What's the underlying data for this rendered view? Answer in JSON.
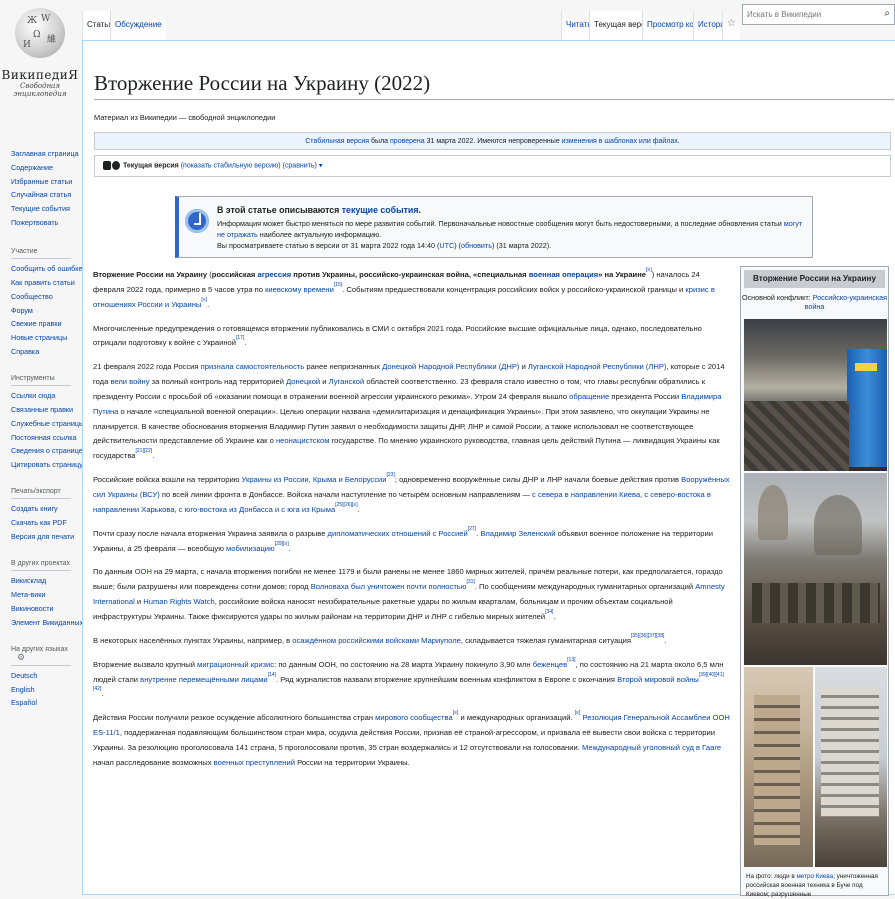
{
  "logo": {
    "wordmark": "ВикипедиЯ",
    "tagline": "Свободная энциклопедия"
  },
  "sidebar": {
    "portal_main": [
      "Заглавная страница",
      "Содержание",
      "Избранные статьи",
      "Случайная статья",
      "Текущие события",
      "Пожертвовать"
    ],
    "participation": {
      "title": "Участие",
      "items": [
        "Сообщить об ошибке",
        "Как править статьи",
        "Сообщество",
        "Форум",
        "Свежие правки",
        "Новые страницы",
        "Справка"
      ]
    },
    "tools": {
      "title": "Инструменты",
      "items": [
        "Ссылки сюда",
        "Связанные правки",
        "Служебные страницы",
        "Постоянная ссылка",
        "Сведения о странице",
        "Цитировать страницу"
      ]
    },
    "print": {
      "title": "Печать/экспорт",
      "items": [
        "Создать книгу",
        "Скачать как PDF",
        "Версия для печати"
      ]
    },
    "projects": {
      "title": "В других проектах",
      "items": [
        "Викисклад",
        "Мета-вики",
        "Викиновости",
        "Элемент Викиданных"
      ]
    },
    "languages": {
      "title": "На других языках",
      "items": [
        "Deutsch",
        "English",
        "Español"
      ]
    }
  },
  "tabs": {
    "article": "Статья",
    "talk": "Обсуждение",
    "read": "Читать",
    "current": "Текущая версия",
    "source": "Просмотр кода",
    "history": "История"
  },
  "search": {
    "placeholder": "Искать в Википедии"
  },
  "page": {
    "title": "Вторжение России на Украину (2022)",
    "site_sub": "Материал из Википедии — свободной энциклопедии"
  },
  "flag": {
    "stable": "Стабильная версия",
    "t1": " была ",
    "checked": "проверена",
    "t2": " 31 марта 2022. Имеются непроверенные ",
    "changes": "изменения в шаблонах или файлах",
    "t3": "."
  },
  "flaggedrev": {
    "bold": "Текущая версия",
    "rest": " (показать стабильную версию) (сравнить) ▾"
  },
  "current_events": {
    "h1": "В этой статье описываются ",
    "hlink": "текущие события",
    "h2": ".",
    "l1a": "Информация может быстро меняться по мере развития событий. Первоначальные новостные сообщения могут быть недостоверными, а последние обновления статьи ",
    "l1link": "могут не отражать",
    "l1b": " наиболее актуальную информацию.",
    "l2a": "Вы просматриваете статью в версии от 31 марта 2022 года 14:40 (",
    "utc": "UTC",
    "l2b": ") (",
    "refresh": "обновить",
    "l2c": ") (31 марта 2022)."
  },
  "infobox": {
    "title": "Вторжение России на Украину",
    "conflict_label": "Основной конфликт: ",
    "conflict_link": "Российско-украинская война",
    "caption_a": "На фото: люди в ",
    "caption_link": "метро Киева",
    "caption_b": "; уничтоженная российская военная техника в Буче под Киевом; разрушенные"
  },
  "body": {
    "p1": {
      "b1": "Вторжение России на Украину",
      "t1": " (",
      "b2": "российская ",
      "l1": "агрессия",
      "b3": " против Украины, российско-украинская война, «специальная ",
      "l2": "военная операция",
      "b4": "» на Украине",
      "t2": ") началось 24 февраля 2022 года, примерно в 5 часов утра по ",
      "l3": "киевскому времени",
      "t3": ". Событиям предшествовали концентрация российских войск у российско-украинской границы и ",
      "l4": "кризис в отношениях России и Украины",
      "t4": "."
    },
    "p2": "Многочисленные предупреждения о готовящемся вторжении публиковались в СМИ с октября 2021 года. Российские высшие официальные лица, однако, последовательно отрицали подготовку к войне с Украиной",
    "p3": {
      "t1": "21 февраля 2022 года Россия ",
      "l1": "признала самостоятельность",
      "t2": " ранее непризнанных ",
      "l2": "Донецкой Народной Республики (ДНР)",
      "t3": " и ",
      "l3": "Луганской Народной Республики (ЛНР)",
      "t4": ", которые с 2014 года ",
      "l4": "вели войну",
      "t5": " за полный контроль над территорией ",
      "l5": "Донецкой",
      "t6": " и ",
      "l6": "Луганской",
      "t7": " областей соответственно. 23 февраля стало известно о том, что главы республик обратились к президенту России с просьбой об «оказании помощи в отражении военной агрессии украинского режима». Утром 24 февраля вышло ",
      "l7": "обращение",
      "t8": " президента России ",
      "l8": "Владимира Путина",
      "t9": " о начале «специальной военной операции». Целью операции названа «демилитаризация и денацификация Украины». При этом заявлено, что оккупации Украины не планируется. В качестве обоснования вторжения Владимир Путин заявил о необходимости защиты ДНР, ЛНР и самой России, а также использовал не соответствующее действительности представление об Украине как о ",
      "l9": "неонацистском",
      "t10": " государстве. По мнению украинского руководства, главная цель действий Путина — ликвидация Украины как государства"
    },
    "p4": {
      "t1": "Российские войска вошли на территорию ",
      "l1": "Украины из России, Крыма и Белоруссии",
      "t2": "; одновременно вооружённые силы ДНР и ЛНР начали боевые действия против ",
      "l2": "Вооружённых сил Украины (ВСУ)",
      "t3": " по всей линии фронта в Донбассе. Войска начали наступление по четырём основным направлениям — ",
      "l3": "с севера в направлении Киева, с северо-востока в направлении Харькова, с юго-востока из Донбасса и с юга из Крыма",
      "t4": "."
    },
    "p5": {
      "t1": "Почти сразу после начала вторжения Украина заявила о разрыве ",
      "l1": "дипломатических отношений с Россией",
      "t2": ". ",
      "l2": "Владимир Зеленский",
      "t3": " объявил военное положение на территории Украины, а 25 февраля — всеобщую ",
      "l3": "мобилизацию",
      "t4": "."
    },
    "p6": {
      "t1": "По данным ",
      "l1": "ООН",
      "t2": " на 29 марта, с начала вторжения погибли не менее 1179 и были ранены не менее 1860 мирных жителей, причём реальные потери, как предполагается, гораздо выше; были разрушены или повреждены сотни домов; город ",
      "l2": "Волноваха был уничтожен почти полностью",
      "t3": ". По сообщениям международных гуманитарных организаций ",
      "l3": "Amnesty International",
      "t4": " и ",
      "l4": "Human Rights Watch",
      "t5": ", российские войска наносят неизбирательные ракетные удары по жилым кварталам, больницам и прочим объектам социальной инфраструктуры Украины. Также фиксируются удары по жилым районам на территории ДНР и ЛНР с гибелью мирных жителей"
    },
    "p7": {
      "t1": "В некоторых населённых пунктах Украины, например, в ",
      "l1": "осаждённом российскими войсками Мариуполе",
      "t2": ", складывается тяжелая гуманитарная ситуация"
    },
    "p8": {
      "t1": "Вторжение вызвало крупный ",
      "l1": "миграционный кризис",
      "t2": ": по данным ООН, по состоянию на 28 марта Украину покинуло 3,90 млн ",
      "l2": "беженцев",
      "t3": ", по состоянию на 21 марта около 6,5 млн людей стали ",
      "l3": "внутренне перемещёнными лицами",
      "t4": ". Ряд журналистов назвали вторжение крупнейшим военным конфликтом в Европе с окончания ",
      "l4": "Второй мировой войны"
    },
    "p9": {
      "t1": "Действия России получили резкое осуждение абсолютного большинства стран ",
      "l1": "мирового сообщества",
      "t2": " и международных организаций. ",
      "l2": "Резолюция Генеральной Ассамблеи ООН ES-11/1",
      "t3": ", поддержанная подавляющим большинством стран мира, осудила действия России, признав её страной-агрессором, и призвала её вывести свои войска с территории Украины. За резолюцию проголосовала 141 страна, 5 проголосовали против, 35 стран воздержались и 12 отсутствовали на голосовании. ",
      "l3": "Международный уголовный суд в Гааге",
      "t4": " начал расследование возможных ",
      "l4": "военных преступлений",
      "t5": " России на территории Украины."
    }
  },
  "refs": {
    "r1": "[≡]",
    "r15": "[15]",
    "r16": "[≡]",
    "r17": "[17]",
    "r18": "[18]",
    "r19": "[19][20]",
    "r20": "[≡]",
    "r21": "[21][22]",
    "r23": "[23]",
    "r24": "[24]",
    "r25": "[25][26][≡]",
    "r27": "[27]",
    "r28": "[28]",
    "r29": "[29][≡]",
    "r12": "[12]",
    "r30": "[30]",
    "r31": "[31]",
    "r32": "[32][33][≡]",
    "r34": "[34]",
    "r35": "[35][36][37][38]",
    "r13": "[13]",
    "r14": "[14]",
    "r39": "[39][40][41][42]",
    "r9a": "[≡]",
    "r9b": "[≡]",
    "r43": "[43][44]",
    "r9c": "[≡]"
  }
}
